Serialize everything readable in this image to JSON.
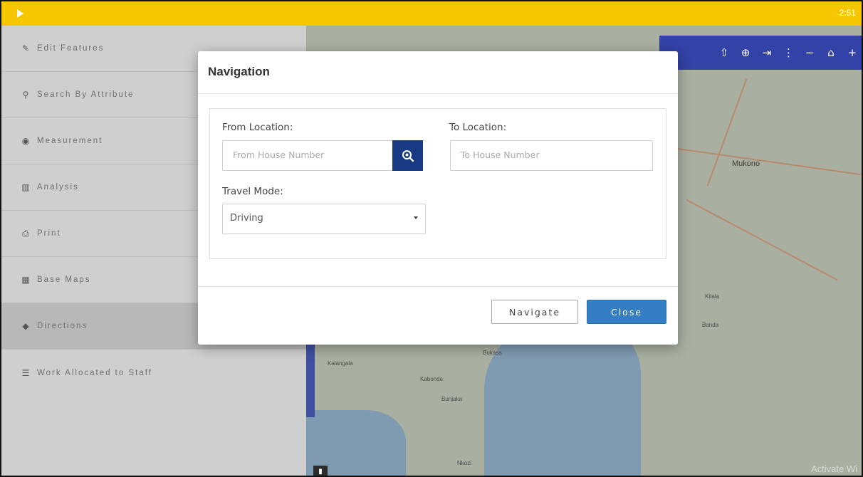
{
  "topbar": {
    "time": "2:51"
  },
  "sidebar": {
    "items": [
      {
        "label": "Edit Features",
        "icon": "edit-icon"
      },
      {
        "label": "Search By Attribute",
        "icon": "search-icon"
      },
      {
        "label": "Measurement",
        "icon": "measure-icon"
      },
      {
        "label": "Analysis",
        "icon": "chart-icon"
      },
      {
        "label": "Print",
        "icon": "print-icon"
      },
      {
        "label": "Base Maps",
        "icon": "map-icon"
      },
      {
        "label": "Directions",
        "icon": "directions-icon",
        "active": true
      },
      {
        "label": "Work Allocated to Staff",
        "icon": "list-icon"
      }
    ]
  },
  "map": {
    "labels": [
      "Mukono",
      "Kalangala",
      "Bukasa",
      "Bunjaka",
      "Nkozi",
      "Kabonde",
      "Banda",
      "Kitala"
    ],
    "watermark": "Activate Wi"
  },
  "modal": {
    "title": "Navigation",
    "from_label": "From Location:",
    "from_placeholder": "From House Number",
    "to_label": "To Location:",
    "to_placeholder": "To House Number",
    "mode_label": "Travel Mode:",
    "mode_value": "Driving",
    "navigate_label": "Navigate",
    "close_label": "Close"
  },
  "colors": {
    "topbar": "#f6c700",
    "toolbar": "#3342a6",
    "search_button": "#183a85",
    "close_button": "#347ec4"
  }
}
